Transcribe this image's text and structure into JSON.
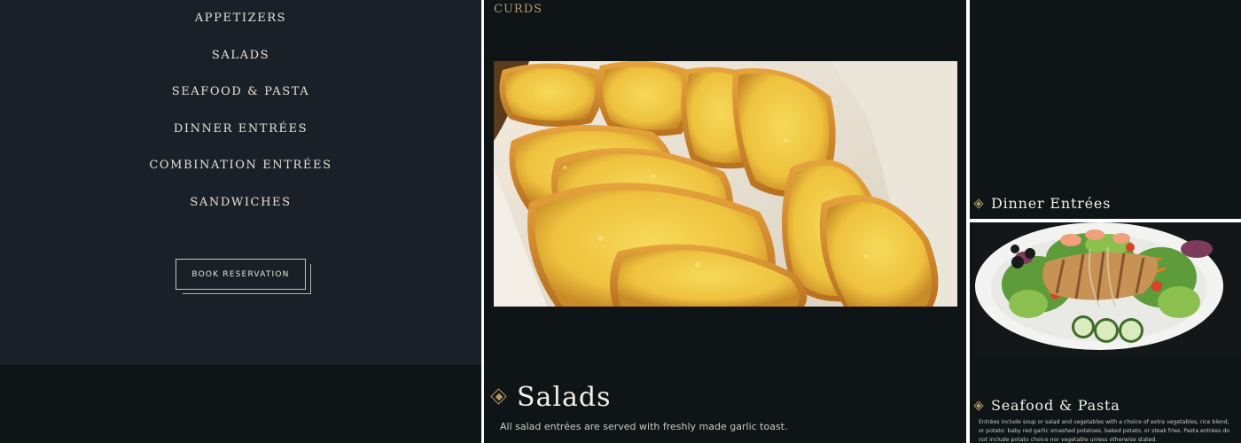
{
  "nav": {
    "items": [
      {
        "label": "APPETIZERS"
      },
      {
        "label": "SALADS"
      },
      {
        "label": "SEAFOOD & PASTA"
      },
      {
        "label": "DINNER ENTRÉES"
      },
      {
        "label": "COMBINATION ENTRÉES"
      },
      {
        "label": "SANDWICHES"
      }
    ],
    "book_label": "BOOK RESERVATION"
  },
  "middle": {
    "curds_label": "CURDS",
    "bread_image_alt": "garlic toast",
    "section_icon": "diamond-icon",
    "section_title": "Salads",
    "section_description": "All salad entrées are served with freshly made garlic toast."
  },
  "right": {
    "dinner_title": "Dinner Entrées",
    "salad_image_alt": "grilled chicken salad",
    "seafood_title": "Seafood & Pasta",
    "seafood_description": "Entrées include soup or salad and vegetables with a choice of extra vegetables, rice blend, or potato: baby red garlic smashed potatoes, baked potato, or steak fries. Pasta entrées do not include potato choice nor vegetable unless otherwise stated."
  },
  "colors": {
    "background_dark": "#0f1417",
    "nav_background": "#1a2028",
    "accent_gold": "#b79a62",
    "text_light": "#f3efe7"
  }
}
